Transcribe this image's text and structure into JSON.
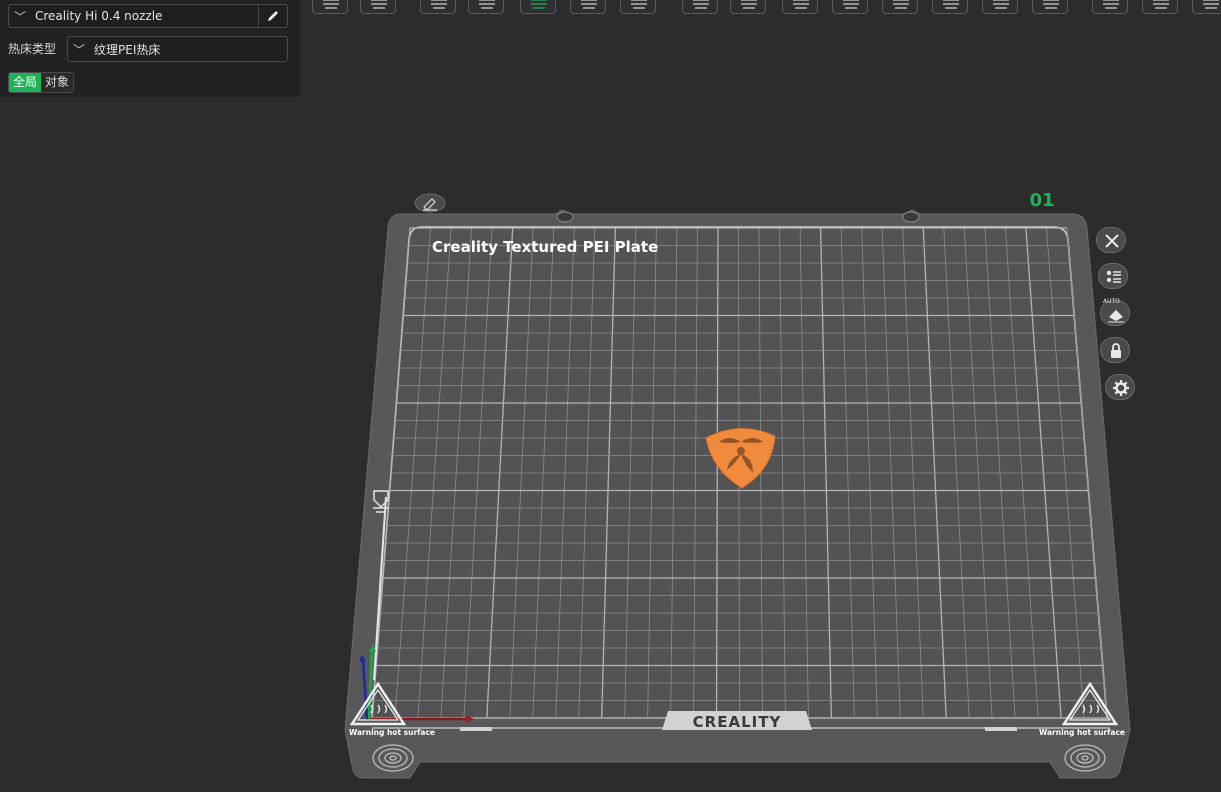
{
  "panel": {
    "printer_preset": "Creality Hi 0.4 nozzle",
    "bed_type_label": "热床类型",
    "bed_type_value": "纹理PEI热床",
    "tabs": [
      {
        "label": "全局",
        "active": true
      },
      {
        "label": "对象",
        "active": false
      }
    ]
  },
  "plate": {
    "title": "Creality Textured PEI Plate",
    "number": "01",
    "brand_label": "CREALITY",
    "warning_left": "Warning hot surface",
    "warning_right": "Warning hot surface",
    "auto_label": "AUTO"
  },
  "colors": {
    "accent": "#1db256",
    "model": "#f08a3c",
    "plate": "#58585b",
    "grid": "#9c9c9e"
  },
  "icons": {
    "toolbar": [
      "add-cube-icon",
      "keyboard-icon",
      "import-icon",
      "orient-icon",
      "auto-arrange-icon",
      "layout-icon",
      "slice-icon",
      "split-objects-icon",
      "split-parts-icon",
      "cut-icon",
      "support-paint-icon",
      "emboss-icon",
      "measure-icon",
      "box-icon",
      "seam-paint-icon",
      "assembly-icon",
      "text-icon",
      "more-icon"
    ],
    "side": [
      "close-icon",
      "list-icon",
      "auto-orient-icon",
      "lock-icon",
      "gear-icon"
    ]
  }
}
